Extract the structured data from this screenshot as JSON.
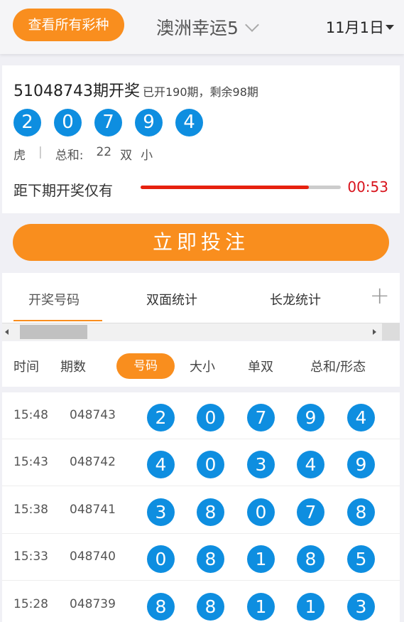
{
  "header": {
    "all_lotteries": "查看所有彩种",
    "lottery_name": "澳洲幸运5",
    "date": "11月1日"
  },
  "draw": {
    "title": "51048743期开奖",
    "subtitle": "已开190期，剩余98期",
    "numbers": [
      "2",
      "0",
      "7",
      "9",
      "4"
    ],
    "dragon_tiger": "虎",
    "sum_label": "总和:",
    "sum_value": "22",
    "odd_even": "双",
    "big_small": "小",
    "countdown_label": "距下期开奖仅有",
    "countdown_time": "00:53",
    "progress_percent": 84
  },
  "bet_button": "立即投注",
  "tabs": [
    {
      "label": "开奖号码",
      "active": true
    },
    {
      "label": "双面统计",
      "active": false
    },
    {
      "label": "长龙统计",
      "active": false
    }
  ],
  "table": {
    "headers": {
      "time": "时间",
      "issue": "期数",
      "number": "号码",
      "size": "大小",
      "parity": "单双",
      "sum": "总和/形态"
    },
    "rows": [
      {
        "time": "15:48",
        "issue": "048743",
        "numbers": [
          "2",
          "0",
          "7",
          "9",
          "4"
        ]
      },
      {
        "time": "15:43",
        "issue": "048742",
        "numbers": [
          "4",
          "0",
          "3",
          "4",
          "9"
        ]
      },
      {
        "time": "15:38",
        "issue": "048741",
        "numbers": [
          "3",
          "8",
          "0",
          "7",
          "8"
        ]
      },
      {
        "time": "15:33",
        "issue": "048740",
        "numbers": [
          "0",
          "8",
          "1",
          "8",
          "5"
        ]
      },
      {
        "time": "15:28",
        "issue": "048739",
        "numbers": [
          "8",
          "8",
          "1",
          "1",
          "3"
        ]
      }
    ]
  },
  "colors": {
    "accent": "#f98e1e",
    "ball": "#0e8ee0",
    "countdown": "#d8131c",
    "progress": "#e6210e"
  }
}
